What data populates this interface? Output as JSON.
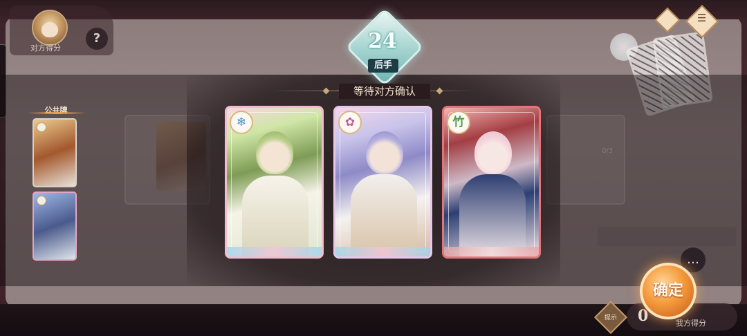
{
  "opponent": {
    "score_label": "对方得分",
    "help_label": "?"
  },
  "public_cards": {
    "label": "公共牌"
  },
  "timer": {
    "value": "24",
    "turn_label": "后手"
  },
  "status": {
    "text": "等待对方确认"
  },
  "board": {
    "progress_text": "0/3"
  },
  "selection_cards": [
    {
      "name": "card-1",
      "emblem": "snow-icon",
      "frame_color": "#f1bcd0"
    },
    {
      "name": "card-2",
      "emblem": "flower-icon",
      "frame_color": "#e8c7ea"
    },
    {
      "name": "card-3",
      "emblem": "bamboo-icon",
      "frame_color": "#e2757a"
    }
  ],
  "actions": {
    "confirm_label": "确定",
    "hint_label": "提示"
  },
  "my_side": {
    "score_value": "0",
    "score_label": "我方得分"
  },
  "colors": {
    "accent_orange": "#f49a3c",
    "timer_teal": "#6fb4b2",
    "status_gold": "#c8aa78"
  }
}
